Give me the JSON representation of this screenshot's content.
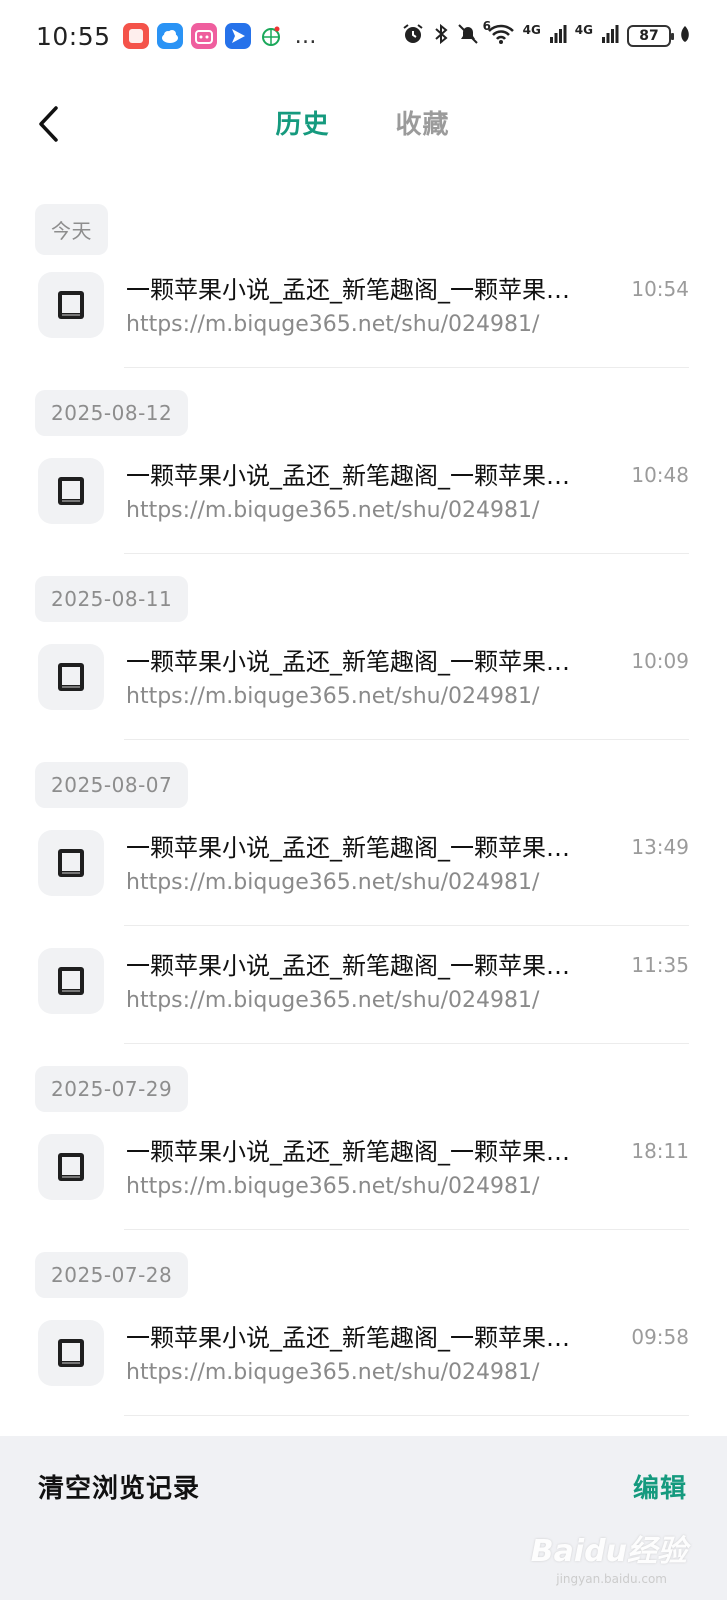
{
  "status_bar": {
    "time": "10:55",
    "net1": "4G",
    "net2": "4G",
    "wifi_sup": "6",
    "battery": "87",
    "more": "…"
  },
  "header": {
    "tabs": [
      {
        "label": "历史",
        "active": true
      },
      {
        "label": "收藏",
        "active": false
      }
    ]
  },
  "history": {
    "groups": [
      {
        "date": "今天",
        "items": [
          {
            "title": "一颗苹果小说_孟还_新笔趣阁_一颗苹果…",
            "url": "https://m.biquge365.net/shu/024981/",
            "time": "10:54"
          }
        ]
      },
      {
        "date": "2025-08-12",
        "items": [
          {
            "title": "一颗苹果小说_孟还_新笔趣阁_一颗苹果…",
            "url": "https://m.biquge365.net/shu/024981/",
            "time": "10:48"
          }
        ]
      },
      {
        "date": "2025-08-11",
        "items": [
          {
            "title": "一颗苹果小说_孟还_新笔趣阁_一颗苹果…",
            "url": "https://m.biquge365.net/shu/024981/",
            "time": "10:09"
          }
        ]
      },
      {
        "date": "2025-08-07",
        "items": [
          {
            "title": "一颗苹果小说_孟还_新笔趣阁_一颗苹果…",
            "url": "https://m.biquge365.net/shu/024981/",
            "time": "13:49"
          },
          {
            "title": "一颗苹果小说_孟还_新笔趣阁_一颗苹果…",
            "url": "https://m.biquge365.net/shu/024981/",
            "time": "11:35"
          }
        ]
      },
      {
        "date": "2025-07-29",
        "items": [
          {
            "title": "一颗苹果小说_孟还_新笔趣阁_一颗苹果…",
            "url": "https://m.biquge365.net/shu/024981/",
            "time": "18:11"
          }
        ]
      },
      {
        "date": "2025-07-28",
        "items": [
          {
            "title": "一颗苹果小说_孟还_新笔趣阁_一颗苹果…",
            "url": "https://m.biquge365.net/shu/024981/",
            "time": "09:58"
          }
        ]
      }
    ]
  },
  "footer": {
    "clear_label": "清空浏览记录",
    "edit_label": "编辑",
    "watermark": "Baidu经验",
    "watermark_sub": "jingyan.baidu.com"
  },
  "colors": {
    "accent": "#159a7e",
    "inactive": "#9b9b9b",
    "chip_bg": "#f1f2f4",
    "footer_bg": "#f0f1f4"
  }
}
